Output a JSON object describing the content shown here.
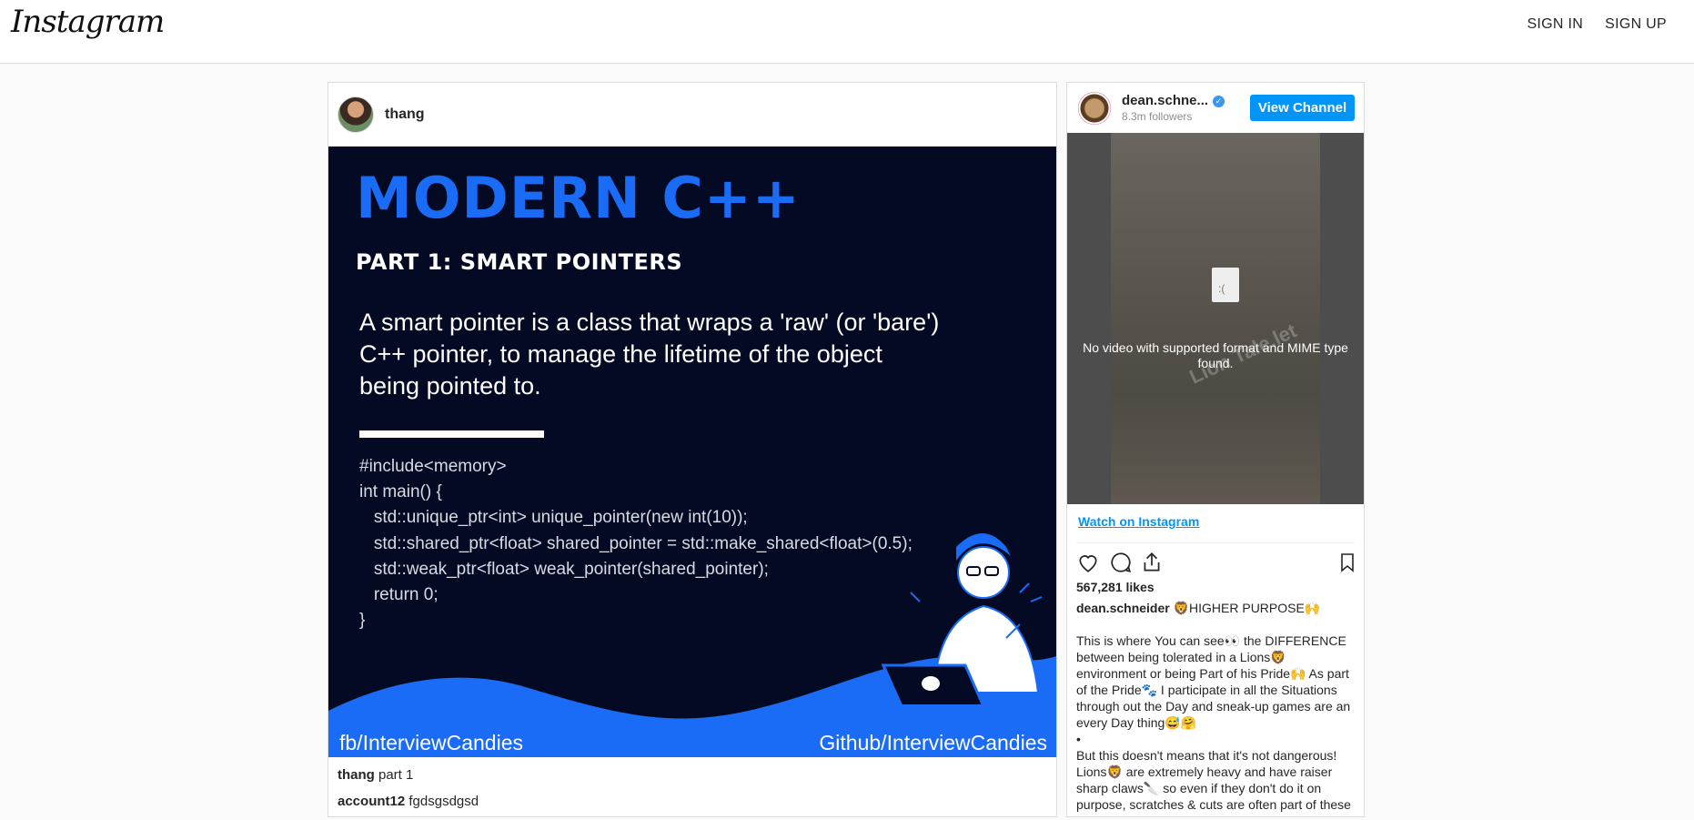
{
  "header": {
    "logo": "Instagram",
    "sign_in": "SIGN IN",
    "sign_up": "SIGN UP"
  },
  "post": {
    "username": "thang",
    "image": {
      "title": "MODERN C++",
      "subtitle": "PART 1:  SMART POINTERS",
      "description": "A smart pointer is a class that wraps a 'raw' (or 'bare') C++ pointer, to manage the lifetime of the object being pointed to.",
      "code": "#include<memory>\nint main() {\n   std::unique_ptr<int> unique_pointer(new int(10));\n   std::shared_ptr<float> shared_pointer = std::make_shared<float>(0.5);\n   std::weak_ptr<float> weak_pointer(shared_pointer);\n   return 0;\n}",
      "footer_left": "fb/InterviewCandies",
      "footer_right": "Github/InterviewCandies"
    },
    "comments": [
      {
        "user": "thang",
        "text": "part 1"
      },
      {
        "user": "account12",
        "text": "fgdsgsdgsd"
      }
    ]
  },
  "embed": {
    "username": "dean.schne...",
    "followers": "8.3m followers",
    "view_channel": "View Channel",
    "video_error": "No video with supported format and MIME type found.",
    "watermark": "Lion Tale.let",
    "watch_link": "Watch on Instagram",
    "likes": "567,281 likes",
    "caption_user": "dean.schneider",
    "caption_lead": "🦁HIGHER PURPOSE🙌",
    "caption_p1": "This is where You can see👀 the DIFFERENCE between being tolerated in a Lions🦁 environment or being Part of his Pride🙌 As part of the Pride🐾 I participate in all the Situations through out the Day and sneak-up games are an every Day thing😅🤗",
    "caption_bullet": "•",
    "caption_p2": "But this doesn't means that it's not dangerous! Lions🦁 are extremely heavy and have raiser sharp claws🔪 so even if they don't do it on purpose, scratches & cuts are often part of these"
  }
}
